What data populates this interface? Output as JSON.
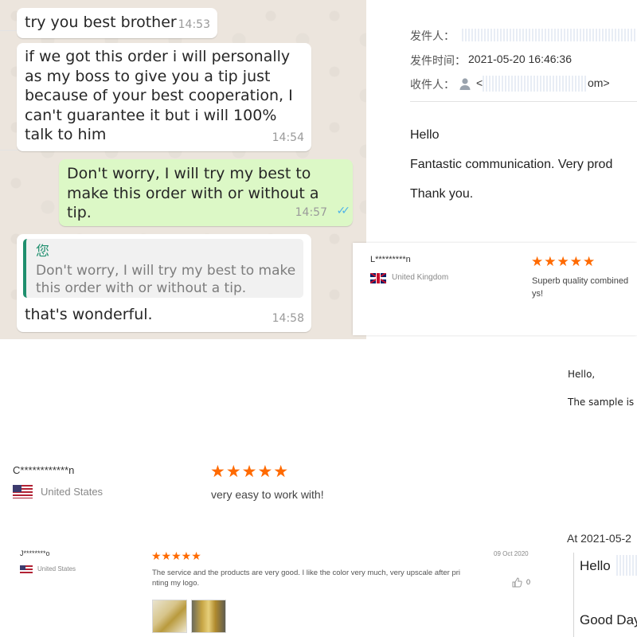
{
  "chat": {
    "messages": [
      {
        "text": "try you best brother",
        "time": "14:53",
        "direction": "incoming"
      },
      {
        "text": "if we got this order i will personally as my boss to give you a tip just because of your best cooperation, I can't guarantee it but i will 100% talk to him",
        "time": "14:54",
        "direction": "incoming"
      },
      {
        "text": "Don't worry, I will try my best to make this order with or without a tip.",
        "time": "14:57",
        "direction": "outgoing",
        "status": "double-check-icon"
      },
      {
        "quote_name": "您",
        "quote_text": "Don't worry, I will try my best to make this order with or without a tip.",
        "text": "that's wonderful.",
        "time": "14:58",
        "direction": "incoming"
      }
    ]
  },
  "email": {
    "sender_label": "发件人：",
    "time_label": "发件时间：",
    "time_value": "2021-05-20 16:46:36",
    "recipient_label": "收件人：",
    "recipient_open": "<",
    "recipient_suffix": "om>",
    "body": [
      "Hello",
      "Fantastic communication. Very prod",
      "Thank you."
    ]
  },
  "review_uk": {
    "user": "L*********n",
    "country": "United Kingdom",
    "stars": "★★★★★",
    "text": "Superb quality combined",
    "text2": "ys!"
  },
  "email_snippet": {
    "greeting": "Hello,",
    "text": "The sample is"
  },
  "review_us_1": {
    "user": "C************n",
    "country": "United States",
    "stars": "★★★★★",
    "text": "very easy to work with!"
  },
  "review_us_2": {
    "user": "J********o",
    "country": "United States",
    "stars": "★★★★★",
    "date": "09 Oct 2020",
    "text": "The service and the products are very good. I like the color very much, very upscale after pri nting my logo.",
    "likes": "0"
  },
  "email_snippet_2": {
    "header": "At 2021-05-2",
    "hello": "Hello",
    "good_day": "Good Day"
  },
  "colors": {
    "chat_background": "#ece5dd",
    "outgoing_bubble": "#dcf8c6",
    "quote_accent": "#1f8f6e",
    "star": "#ff6a00",
    "read_ticks": "#4fb3e8"
  }
}
